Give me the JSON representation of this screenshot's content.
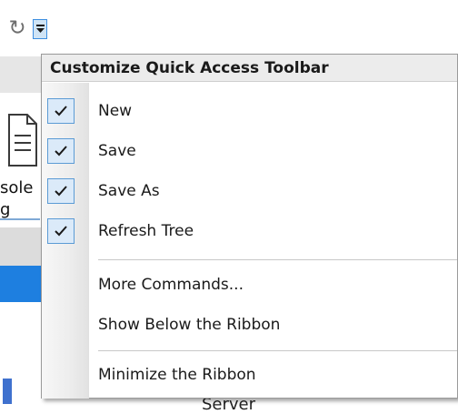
{
  "toolbar": {
    "refresh_glyph": "↻",
    "dropdown_icon": "customize-qat-arrow"
  },
  "background": {
    "label_line1": "sole",
    "label_line2": "g",
    "bottom_text": "Server"
  },
  "menu": {
    "title": "Customize Quick Access Toolbar",
    "items": [
      {
        "label": "New",
        "checked": true
      },
      {
        "label": "Save",
        "checked": true
      },
      {
        "label": "Save As",
        "checked": true
      },
      {
        "label": "Refresh Tree",
        "checked": true
      },
      {
        "label": "More Commands...",
        "checked": false
      },
      {
        "label": "Show Below the Ribbon",
        "checked": false
      },
      {
        "label": "Minimize the Ribbon",
        "checked": false
      }
    ]
  },
  "colors": {
    "check_bg": "#dbeaf9",
    "check_border": "#5b9bd5",
    "accent_blue": "#1e7fe0"
  }
}
